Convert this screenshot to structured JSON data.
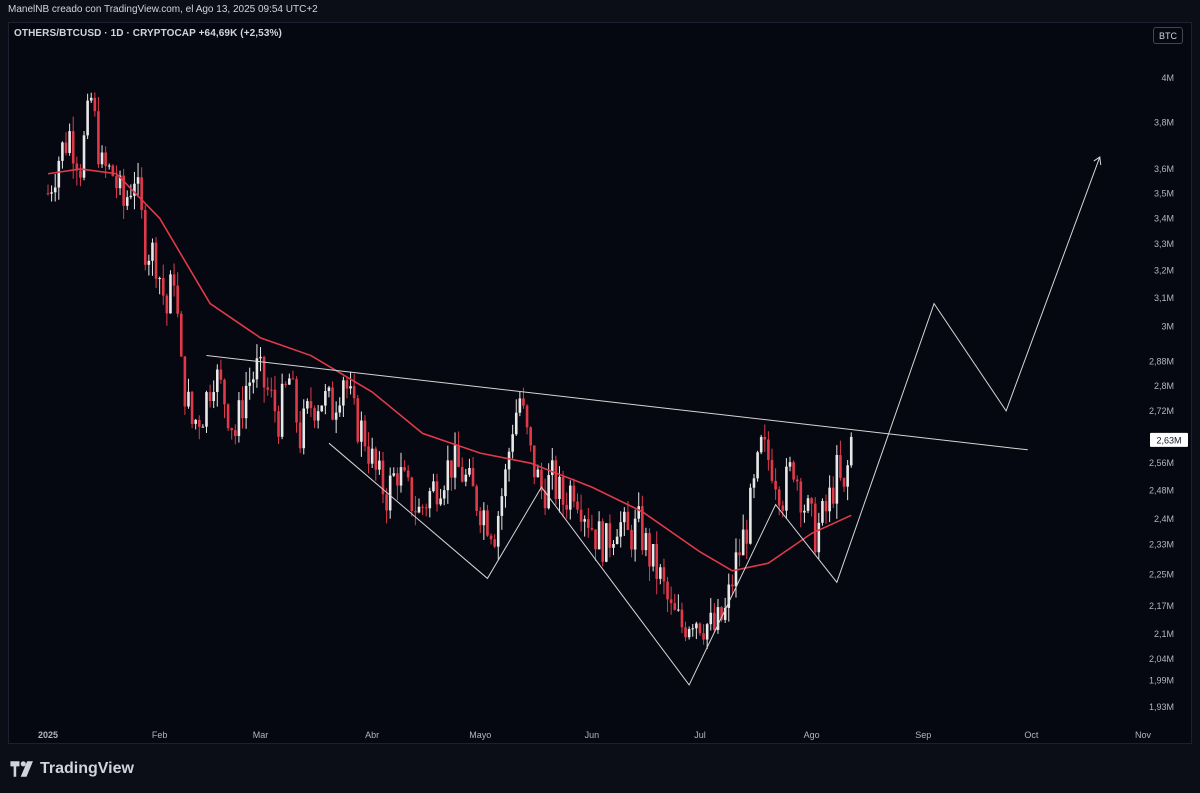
{
  "header": {
    "creator_line": "ManelNB creado con TradingView.com, el Ago 13, 2025 09:54 UTC+2",
    "legend": "OTHERS/BTCUSD · 1D · CRYPTOCAP  +64,69K (+2,53%)",
    "currency_badge": "BTC"
  },
  "footer": {
    "brand": "TradingView"
  },
  "colors": {
    "background": "#050810",
    "up_candle": "#e8e8e8",
    "down_candle": "#e03a4a",
    "moving_average": "#e03a4a",
    "drawings": "#d6d6d6",
    "price_badge_bg": "#ffffff"
  },
  "chart_data": {
    "type": "candlestick",
    "symbol": "OTHERS/BTCUSD",
    "interval": "1D",
    "scale": "log",
    "last_price_label": "2,63M",
    "y_ticks": [
      "4M",
      "3,8M",
      "3,6M",
      "3,5M",
      "3,4M",
      "3,3M",
      "3,2M",
      "3,1M",
      "3M",
      "2,88M",
      "2,8M",
      "2,72M",
      "2,56M",
      "2,48M",
      "2,4M",
      "2,33M",
      "2,25M",
      "2,17M",
      "2,1M",
      "2,04M",
      "1,99M",
      "1,93M"
    ],
    "y_tick_values": [
      4000000,
      3800000,
      3600000,
      3500000,
      3400000,
      3300000,
      3200000,
      3100000,
      3000000,
      2880000,
      2800000,
      2720000,
      2560000,
      2480000,
      2400000,
      2330000,
      2250000,
      2170000,
      2100000,
      2040000,
      1990000,
      1930000
    ],
    "x_ticks": [
      "2025",
      "Feb",
      "Mar",
      "Abr",
      "Mayo",
      "Jun",
      "Jul",
      "Ago",
      "Sep",
      "Oct",
      "Nov"
    ],
    "x_tick_dates": [
      "2025-01-01",
      "2025-02-01",
      "2025-03-01",
      "2025-04-01",
      "2025-05-01",
      "2025-06-01",
      "2025-07-01",
      "2025-08-01",
      "2025-09-01",
      "2025-10-01",
      "2025-11-01"
    ],
    "close_path": [
      [
        "2025-01-01",
        3500000
      ],
      [
        "2025-01-04",
        3650000
      ],
      [
        "2025-01-07",
        3750000
      ],
      [
        "2025-01-10",
        3620000
      ],
      [
        "2025-01-13",
        3900000
      ],
      [
        "2025-01-16",
        3600000
      ],
      [
        "2025-01-19",
        3580000
      ],
      [
        "2025-01-22",
        3450000
      ],
      [
        "2025-01-25",
        3580000
      ],
      [
        "2025-01-28",
        3300000
      ],
      [
        "2025-01-31",
        3250000
      ],
      [
        "2025-02-03",
        3050000
      ],
      [
        "2025-02-05",
        3200000
      ],
      [
        "2025-02-07",
        2850000
      ],
      [
        "2025-02-10",
        2680000
      ],
      [
        "2025-02-13",
        2720000
      ],
      [
        "2025-02-16",
        2850000
      ],
      [
        "2025-02-19",
        2760000
      ],
      [
        "2025-02-22",
        2650000
      ],
      [
        "2025-02-25",
        2800000
      ],
      [
        "2025-02-28",
        2850000
      ],
      [
        "2025-03-03",
        2780000
      ],
      [
        "2025-03-06",
        2700000
      ],
      [
        "2025-03-09",
        2820000
      ],
      [
        "2025-03-12",
        2640000
      ],
      [
        "2025-03-15",
        2740000
      ],
      [
        "2025-03-18",
        2760000
      ],
      [
        "2025-03-21",
        2730000
      ],
      [
        "2025-03-24",
        2840000
      ],
      [
        "2025-03-27",
        2700000
      ],
      [
        "2025-03-30",
        2640000
      ],
      [
        "2025-04-02",
        2530000
      ],
      [
        "2025-04-05",
        2470000
      ],
      [
        "2025-04-08",
        2540000
      ],
      [
        "2025-04-11",
        2470000
      ],
      [
        "2025-04-14",
        2420000
      ],
      [
        "2025-04-17",
        2470000
      ],
      [
        "2025-04-20",
        2520000
      ],
      [
        "2025-04-23",
        2560000
      ],
      [
        "2025-04-26",
        2530000
      ],
      [
        "2025-04-29",
        2470000
      ],
      [
        "2025-05-02",
        2420000
      ],
      [
        "2025-05-05",
        2370000
      ],
      [
        "2025-05-08",
        2520000
      ],
      [
        "2025-05-10",
        2680000
      ],
      [
        "2025-05-12",
        2760000
      ],
      [
        "2025-05-15",
        2580000
      ],
      [
        "2025-05-18",
        2480000
      ],
      [
        "2025-05-21",
        2510000
      ],
      [
        "2025-05-24",
        2450000
      ],
      [
        "2025-05-27",
        2500000
      ],
      [
        "2025-05-30",
        2430000
      ],
      [
        "2025-06-02",
        2360000
      ],
      [
        "2025-06-05",
        2330000
      ],
      [
        "2025-06-08",
        2400000
      ],
      [
        "2025-06-11",
        2350000
      ],
      [
        "2025-06-14",
        2380000
      ],
      [
        "2025-06-17",
        2300000
      ],
      [
        "2025-06-20",
        2240000
      ],
      [
        "2025-06-23",
        2150000
      ],
      [
        "2025-06-26",
        2120000
      ],
      [
        "2025-06-29",
        2150000
      ],
      [
        "2025-07-02",
        2130000
      ],
      [
        "2025-07-05",
        2110000
      ],
      [
        "2025-07-08",
        2150000
      ],
      [
        "2025-07-11",
        2280000
      ],
      [
        "2025-07-14",
        2380000
      ],
      [
        "2025-07-16",
        2480000
      ],
      [
        "2025-07-18",
        2600000
      ],
      [
        "2025-07-21",
        2560000
      ],
      [
        "2025-07-24",
        2470000
      ],
      [
        "2025-07-27",
        2560000
      ],
      [
        "2025-07-30",
        2440000
      ],
      [
        "2025-08-02",
        2360000
      ],
      [
        "2025-08-05",
        2420000
      ],
      [
        "2025-08-08",
        2530000
      ],
      [
        "2025-08-10",
        2460000
      ],
      [
        "2025-08-12",
        2630000
      ]
    ],
    "moving_average": [
      [
        "2025-01-01",
        3580000
      ],
      [
        "2025-01-10",
        3600000
      ],
      [
        "2025-01-20",
        3580000
      ],
      [
        "2025-02-01",
        3400000
      ],
      [
        "2025-02-15",
        3080000
      ],
      [
        "2025-03-01",
        2960000
      ],
      [
        "2025-03-15",
        2900000
      ],
      [
        "2025-04-01",
        2780000
      ],
      [
        "2025-04-15",
        2650000
      ],
      [
        "2025-05-01",
        2590000
      ],
      [
        "2025-05-15",
        2560000
      ],
      [
        "2025-06-01",
        2490000
      ],
      [
        "2025-06-15",
        2420000
      ],
      [
        "2025-07-01",
        2310000
      ],
      [
        "2025-07-10",
        2260000
      ],
      [
        "2025-07-20",
        2280000
      ],
      [
        "2025-08-01",
        2360000
      ],
      [
        "2025-08-12",
        2410000
      ]
    ],
    "resistance_line": [
      [
        "2025-02-14",
        2900000
      ],
      [
        "2025-09-30",
        2600000
      ]
    ],
    "zigzag_drawing": [
      [
        "2025-03-20",
        2620000
      ],
      [
        "2025-05-03",
        2240000
      ],
      [
        "2025-05-18",
        2490000
      ],
      [
        "2025-06-28",
        1980000
      ],
      [
        "2025-07-22",
        2440000
      ],
      [
        "2025-08-08",
        2230000
      ],
      [
        "2025-09-04",
        3080000
      ],
      [
        "2025-09-24",
        2720000
      ],
      [
        "2025-10-20",
        3650000
      ]
    ]
  }
}
